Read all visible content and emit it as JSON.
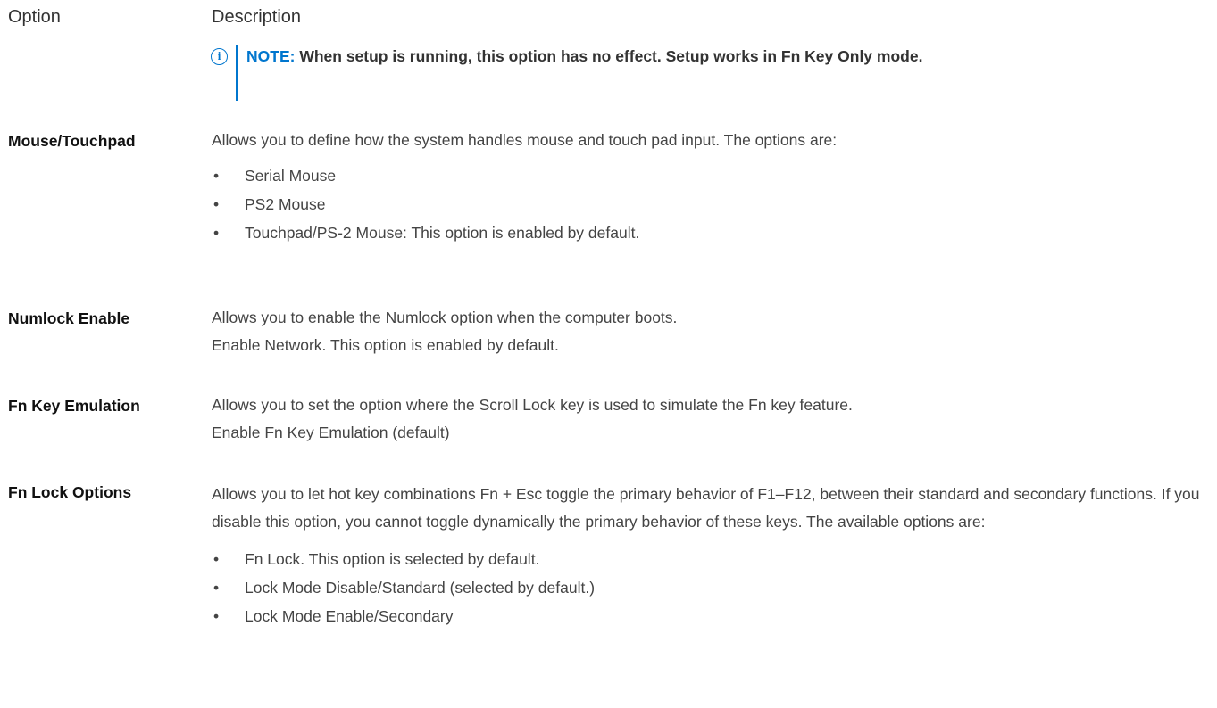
{
  "header": {
    "option": "Option",
    "description": "Description"
  },
  "note": {
    "icon": "info-icon",
    "label": "NOTE:",
    "text": "When setup is running, this option has no effect. Setup works in Fn Key Only mode."
  },
  "rows": [
    {
      "option": "Mouse/Touchpad",
      "lines": [
        "Allows you to define how the system handles mouse and touch pad input. The options are:"
      ],
      "bullets": [
        "Serial Mouse",
        "PS2 Mouse",
        "Touchpad/PS-2 Mouse: This option is enabled by default."
      ]
    },
    {
      "option": "Numlock Enable",
      "lines": [
        "Allows you to enable the Numlock option when the computer boots.",
        "Enable Network. This option is enabled by default."
      ],
      "bullets": []
    },
    {
      "option": "Fn Key Emulation",
      "lines": [
        "Allows you to set the option where the Scroll Lock key is used to simulate the Fn key feature.",
        "Enable Fn Key Emulation (default)"
      ],
      "bullets": []
    },
    {
      "option": "Fn Lock Options",
      "lines": [
        "Allows you to let hot key combinations Fn + Esc toggle the primary behavior of F1–F12, between their standard and secondary functions. If you disable this option, you cannot toggle dynamically the primary behavior of these keys. The available options are:"
      ],
      "bullets": [
        "Fn Lock. This option is selected by default.",
        "Lock Mode Disable/Standard (selected by default.)",
        "Lock Mode Enable/Secondary"
      ]
    }
  ]
}
